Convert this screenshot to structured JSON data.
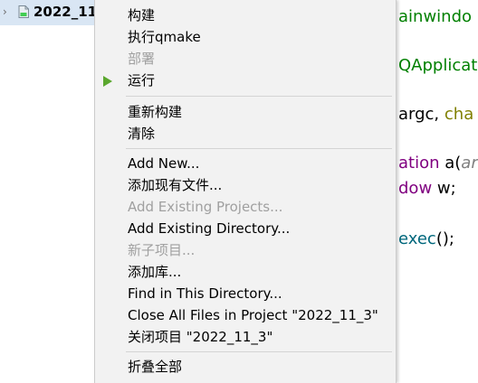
{
  "tree": {
    "project_label": "2022_11_",
    "expand_icon": "chevron-right-icon",
    "project_icon": "qt-project-icon"
  },
  "editor": {
    "line1": "ainwindo",
    "line2": "QApplicati",
    "line3_a": "argc, ",
    "line3_b": "cha",
    "line4_a": "ation ",
    "line4_b": "a(",
    "line4_c": "arg",
    "line5_a": "dow ",
    "line5_b": "w;",
    "line6_a": "exec",
    "line6_b": "();"
  },
  "menu": {
    "items": [
      {
        "label": "构建",
        "enabled": true
      },
      {
        "label": "执行qmake",
        "enabled": true
      },
      {
        "label": "部署",
        "enabled": false
      },
      {
        "label": "运行",
        "enabled": true,
        "icon": "run-arrow-icon"
      },
      {
        "label": "重新构建",
        "enabled": true
      },
      {
        "label": "清除",
        "enabled": true
      },
      {
        "label": "Add New...",
        "enabled": true
      },
      {
        "label": "添加现有文件...",
        "enabled": true
      },
      {
        "label": "Add Existing Projects...",
        "enabled": false
      },
      {
        "label": "Add Existing Directory...",
        "enabled": true
      },
      {
        "label": "新子项目...",
        "enabled": false
      },
      {
        "label": "添加库...",
        "enabled": true
      },
      {
        "label": "Find in This Directory...",
        "enabled": true
      },
      {
        "label": "Close All Files in Project \"2022_11_3\"",
        "enabled": true
      },
      {
        "label": "关闭项目 \"2022_11_3\"",
        "enabled": true
      },
      {
        "label": "折叠全部",
        "enabled": true
      }
    ]
  },
  "colors": {
    "menu_bg": "#f2f2f2",
    "disabled_text": "#a0a0a0",
    "run_arrow": "#5aa72e",
    "tree_selection": "#d9e6f4"
  }
}
